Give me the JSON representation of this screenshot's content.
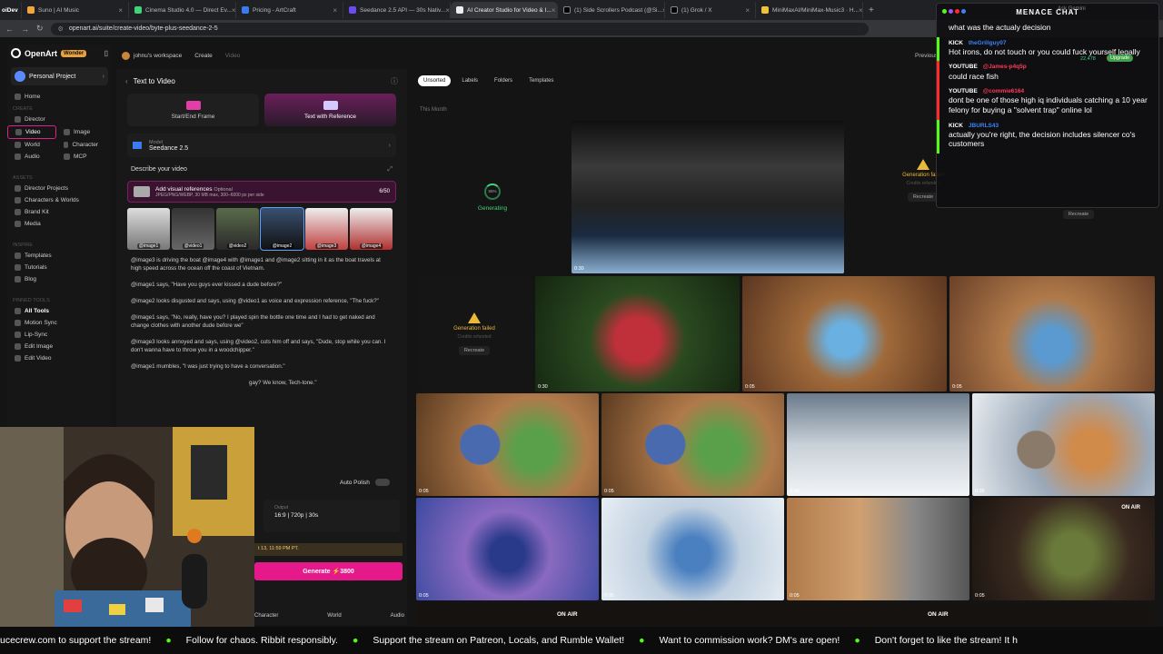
{
  "browser": {
    "tabs": [
      {
        "label": "Suno | AI Music",
        "color": "#f0a63a"
      },
      {
        "label": "Cinema Studio 4.0 — Direct Ev...",
        "color": "#41d37a"
      },
      {
        "label": "Pricing - ArtCraft",
        "color": "#3a7cf0"
      },
      {
        "label": "Seedance 2.5 API — 30s Nativ...",
        "color": "#6b4cf0"
      },
      {
        "label": "AI Creator Studio for Video & I...",
        "color": "#eee"
      },
      {
        "label": "(1) Side Scrollers Podcast (@Si...",
        "color": "#eee"
      },
      {
        "label": "(1) Grok / X",
        "color": "#eee"
      },
      {
        "label": "MiniMaxAI/MiniMax-Music3 · H...",
        "color": "#f0c23a"
      }
    ],
    "url": "openart.ai/suite/create-video/byte-plus-seedance-2-5"
  },
  "sidebar": {
    "brand": "OpenArt",
    "badge": "Wonder",
    "project": "Personal Project",
    "home": "Home",
    "create_section": "CREATE",
    "director": "Director",
    "video": "Video",
    "image": "Image",
    "world": "World",
    "character": "Character",
    "audio": "Audio",
    "mcp": "MCP",
    "assets_section": "ASSETS",
    "assets": [
      "Director Projects",
      "Characters & Worlds",
      "Brand Kit",
      "Media"
    ],
    "inspire_section": "INSPIRE",
    "inspire": [
      "Templates",
      "Tutorials",
      "Blog"
    ],
    "tools_section": "PINNED TOOLS",
    "tools": [
      "All Tools",
      "Motion Sync",
      "Lip-Sync",
      "Edit Image",
      "Edit Video"
    ]
  },
  "header": {
    "workspace": "johnu's workspace",
    "crumb1": "Create",
    "crumb2": "Video",
    "previous": "Previous"
  },
  "panel": {
    "title": "Text to Video",
    "mode1": "Start/End Frame",
    "mode2": "Text with Reference",
    "model_label": "Model",
    "model": "Seedance 2.5",
    "describe": "Describe your video",
    "refs_title": "Add visual references",
    "refs_optional": "Optional",
    "refs_sub": "JPEG/PNG/WEBP, 30 MB max, 300–6000 px per side",
    "refs_count": "6/50",
    "thumb_labels": [
      "@image1",
      "@video1",
      "@video2",
      "@image2",
      "@image3",
      "@image4"
    ],
    "prompt": [
      "@image3 is driving the boat @image4 with @image1 and @image2 sitting in it as the boat travels at high speed across the ocean off the coast of Vietnam.",
      "@image1 says, \"Have you guys ever kissed a dude before?\"",
      "@image2 looks disgusted and says, using @video1 as voice and expression reference, \"The fuck?\"",
      "@image1 says, \"No, really, have you? I played spin the bottle one time and I had to get naked and change clothes with another dude before we\"",
      "@image3 looks annoyed and says, using @video2, cuts him off and says, \"Dude, stop while you can. I don't wanna have to throw you in a woodchipper.\"",
      "@image1 mumbles, \"I was just trying to have a conversation.\"",
      "gay? We know, Tech-tone.\""
    ],
    "auto_polish": "Auto Polish",
    "output_label": "Output",
    "output": "16:9 | 720p | 30s",
    "date": "t 13, 11:59 PM PT.",
    "generate": "Generate ⚡3800",
    "bottom_tabs": [
      "Character",
      "World",
      "Audio"
    ]
  },
  "gallery": {
    "filters": [
      "Unsorted",
      "Labels",
      "Folders",
      "Templates"
    ],
    "month": "This Month",
    "generating": "Generating",
    "progress": "55%",
    "failed": "Generation failed",
    "credits": "Credits refunded",
    "recreate": "Recreate",
    "durations": [
      "0:30",
      "0:30",
      "0:05",
      "0:05",
      "0:05",
      "0:05",
      "0:05",
      "0:05",
      "0:05",
      "0:05",
      "0:05",
      "0:05"
    ],
    "on_air": "ON AIR"
  },
  "chat": {
    "title": "MENACE CHAT",
    "ask": "Ask Gemini",
    "credits": "22,478",
    "upgrade": "Upgrade",
    "messages": [
      {
        "platform": "",
        "user": "",
        "text": "what was the actualy decision",
        "type": "plain"
      },
      {
        "platform": "KICK",
        "user": "theGrillguy07",
        "text": "Hot irons, do not touch or you could fuck yourself legally",
        "type": "kick"
      },
      {
        "platform": "YOUTUBE",
        "user": "@James-p4q5p",
        "text": "could race fish",
        "type": "yt"
      },
      {
        "platform": "YOUTUBE",
        "user": "@commie6164",
        "text": "dont be one of those high iq individuals catching a 10 year felony for buying a \"solvent trap\" online lol",
        "type": "yt"
      },
      {
        "platform": "KICK",
        "user": "JBURLS43",
        "text": "actually you're right, the decision includes silencer co's customers",
        "type": "kick"
      }
    ]
  },
  "ticker": [
    "ucecrew.com to support the stream!",
    "Follow for chaos. Ribbit responsibly.",
    "Support the stream on Patreon, Locals, and Rumble Wallet!",
    "Want to commission work? DM's are open!",
    "Don't forget to like the stream! It h"
  ]
}
